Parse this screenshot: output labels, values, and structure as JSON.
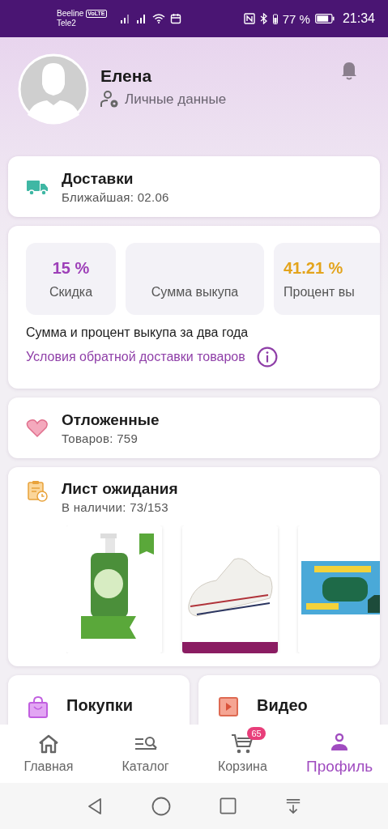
{
  "status_bar": {
    "carrier_1": "Beeline",
    "volte": "VoLTE",
    "carrier_2": "Tele2",
    "battery": "77 %",
    "time": "21:34"
  },
  "profile": {
    "name": "Елена",
    "personal_link": "Личные данные"
  },
  "delivery": {
    "title": "Доставки",
    "subtitle": "Ближайшая: 02.06"
  },
  "stats": {
    "tiles": [
      {
        "kind": "discount",
        "value": "15 %",
        "label": "Скидка"
      },
      {
        "kind": "sum",
        "label": "Сумма выкупа"
      },
      {
        "kind": "percent",
        "value": "41.21 %",
        "label": "Процент вы"
      }
    ],
    "note": "Сумма и процент выкупа за два года",
    "link": "Условия обратной доставки товаров"
  },
  "favorites": {
    "title": "Отложенные",
    "subtitle": "Товаров: 759"
  },
  "waitlist": {
    "title": "Лист ожидания",
    "subtitle": "В наличии: 73/153"
  },
  "shortcuts": [
    {
      "kind": "purchases",
      "title": "Покупки"
    },
    {
      "kind": "video",
      "title": "Видео"
    }
  ],
  "nav": [
    {
      "kind": "home",
      "label": "Главная",
      "selected": false
    },
    {
      "kind": "catalog",
      "label": "Каталог",
      "selected": false
    },
    {
      "kind": "cart",
      "label": "Корзина",
      "badge": "65",
      "selected": false
    },
    {
      "kind": "profile",
      "label": "Профиль",
      "selected": true
    }
  ]
}
